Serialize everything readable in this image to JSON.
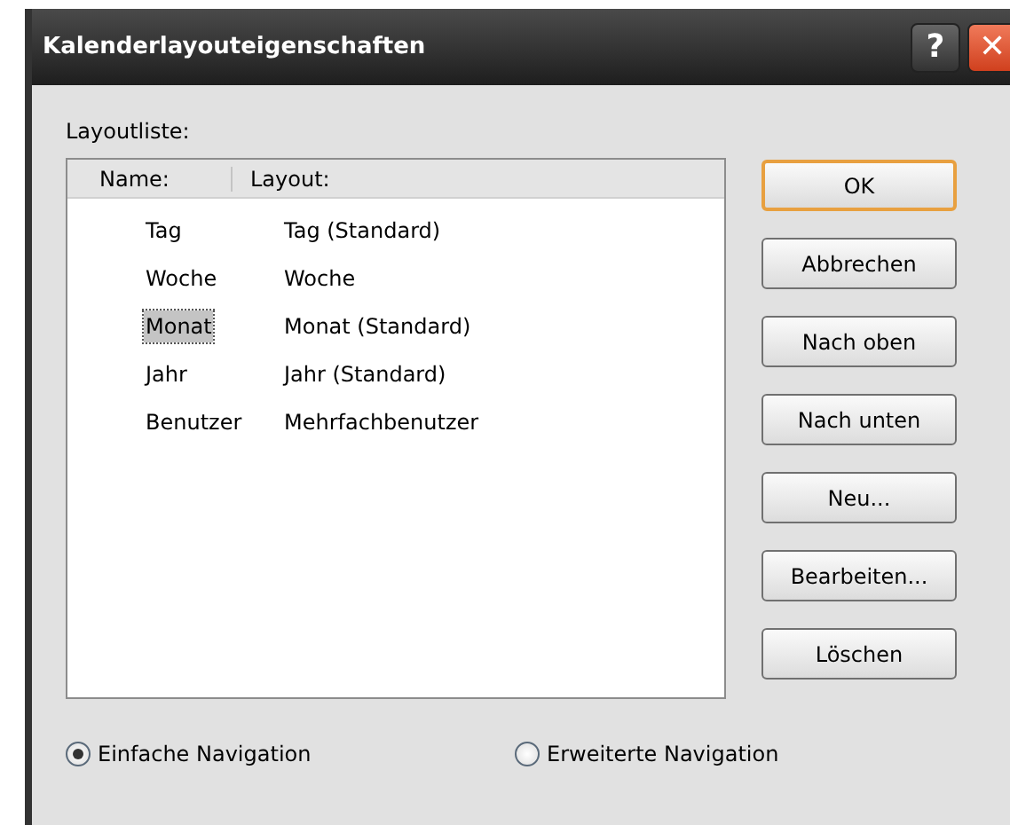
{
  "window": {
    "title": "Kalenderlayouteigenschaften",
    "title_buttons": [
      {
        "kind": "help",
        "label": "?"
      },
      {
        "kind": "close",
        "label": "✕"
      }
    ]
  },
  "layout_list": {
    "label": "Layoutliste:",
    "columns": [
      "Name:",
      "Layout:"
    ],
    "rows": [
      {
        "name": "Tag",
        "layout": "Tag (Standard)",
        "selected": false
      },
      {
        "name": "Woche",
        "layout": "Woche",
        "selected": false
      },
      {
        "name": "Monat",
        "layout": "Monat (Standard)",
        "selected": true
      },
      {
        "name": "Jahr",
        "layout": "Jahr (Standard)",
        "selected": false
      },
      {
        "name": "Benutzer",
        "layout": "Mehrfachbenutzer",
        "selected": false
      }
    ]
  },
  "buttons": [
    {
      "label": "OK",
      "default": true
    },
    {
      "label": "Abbrechen",
      "default": false
    },
    {
      "label": "Nach oben",
      "default": false
    },
    {
      "label": "Nach unten",
      "default": false
    },
    {
      "label": "Neu...",
      "default": false
    },
    {
      "label": "Bearbeiten...",
      "default": false
    },
    {
      "label": "Löschen",
      "default": false
    }
  ],
  "navigation": [
    {
      "label": "Einfache Navigation",
      "selected": true
    },
    {
      "label": "Erweiterte Navigation",
      "selected": false
    }
  ]
}
